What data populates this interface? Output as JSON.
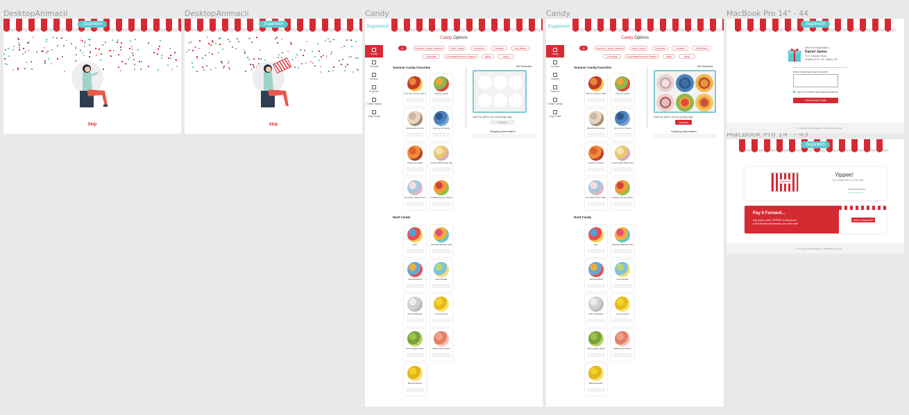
{
  "frames": {
    "desktop1": {
      "label": "DesktopAnimacii",
      "skip": "Skip",
      "logo": "Sugarwish"
    },
    "desktop2": {
      "label": "DesktopAnimacii",
      "skip": "Skip",
      "logo": "Sugarwish"
    },
    "candy1": {
      "label": "Candy",
      "logo": "Sugarwish",
      "title_accent": "Candy",
      "title_rest": " Options",
      "sidebar": [
        "Candy",
        "Cookies",
        "Snacks",
        "Popcorn",
        "Cotton Candy",
        "Dog Treats"
      ],
      "filters": [
        "All",
        "Summer Candy Favorites",
        "Hard Candy",
        "Gummies",
        "Chewies",
        "Jelly Beans",
        "Chocolate",
        "Chocolate/Nonchoc Mixture",
        "Mints",
        "Nutty"
      ],
      "summer_title": "Summer Candy Favorites",
      "summer_items": [
        "Summer Gummy Worms",
        "Fruit Art Candy",
        "Rainbow Art Candy",
        "Gummy Art Candy",
        "Peach Art Candy",
        "Cotton Swirl Sweet Taffy",
        "Ice Cream Shop Gummies",
        "Straight Gummy Sweet Bee"
      ],
      "hard_title": "Hard Candy",
      "hard_items": [
        "Mint",
        "Ultimate Rainbow Twists",
        "Jelly Breadfruit",
        "Lemonheads",
        "Mint Toothpaste",
        "Lemon Drops",
        "Green Apple Drops",
        "Watermelon Drops",
        "Banana Hearts"
      ],
      "selected": "0/6 Selected",
      "terms": "Add my gift to my shopping bag",
      "continue": "Continue",
      "shipping": "Shipping Information"
    },
    "candy2": {
      "label": "Candy",
      "logo": "Sugarwish",
      "title_accent": "Candy",
      "title_rest": " Options",
      "sidebar": [
        "Candy",
        "Cookies",
        "Snacks",
        "Popcorn",
        "Cotton Candy",
        "Dog Treats"
      ],
      "filters": [
        "All",
        "Summer Candy Favorites",
        "Hard Candy",
        "Gummies",
        "Chewies",
        "Jelly Beans",
        "Chocolate",
        "Chocolate/Nonchoc Mixture",
        "Mints",
        "Nutty"
      ],
      "summer_title": "Summer Candy Favorites",
      "summer_items": [
        "Summer Gummy Worms",
        "Fruit Art Candy",
        "Rainbow Art Candy",
        "Gummy Art Candy",
        "Peach Art Candy",
        "Cotton Swirl Sweet Taffy",
        "Ice Cream Shop Jelly Beans",
        "Straight Gummy Sweet Bee"
      ],
      "hard_title": "Hard Candy",
      "hard_items": [
        "Mint",
        "Ultimate Rainbow Twists",
        "Jelly Breadfruit",
        "Lemonheads",
        "Mint Toothpaste",
        "Lemon Drops",
        "Green Apple Drops",
        "Watermelon Drops",
        "Banana Hearts"
      ],
      "selected": "6/6 Selected",
      "terms": "Add my gift to my shopping bag",
      "continue": "Continue",
      "shipping": "Shipping Information"
    },
    "mac44": {
      "label": "MacBook Pro 14\" - 44",
      "logo": "Sugarwish",
      "sent_to": "Send the Sugarwish to",
      "name": "Daniel James",
      "address": "TCC Camden Road, CHARLOTTE, NC, 28204, US",
      "note_label": "Send a thank you note to Daniel",
      "checkbox": "Opt in to receive news and promotions",
      "submit": "Send me my Treats",
      "footer": "© Copyright 2022 Sugarwish. All Rights Reserved"
    },
    "mac45": {
      "label": "MacBook Pro 14\" - 45",
      "logo": "Sugarwish",
      "card_logo": "Sugarwish",
      "yippee": "Yippee!",
      "yippee_sub": "Your Sugarwish is on its way!",
      "track": "Estimated delivery",
      "track_link": "Add to calendar",
      "pay_title": "Pay It Forward...",
      "pay_line1": "Use promo code \"YIPPEE\" to choose for",
      "pay_line2": "a $10.00 discount towards your next order",
      "pay_btn": "Send a Sugarwish",
      "footer": "© Copyright 2022 Sugarwish. All Rights Reserved"
    }
  },
  "colors": {
    "brand_red": "#d62a33",
    "brand_teal": "#5ec7cf",
    "canvas": "#e9e9e9"
  }
}
